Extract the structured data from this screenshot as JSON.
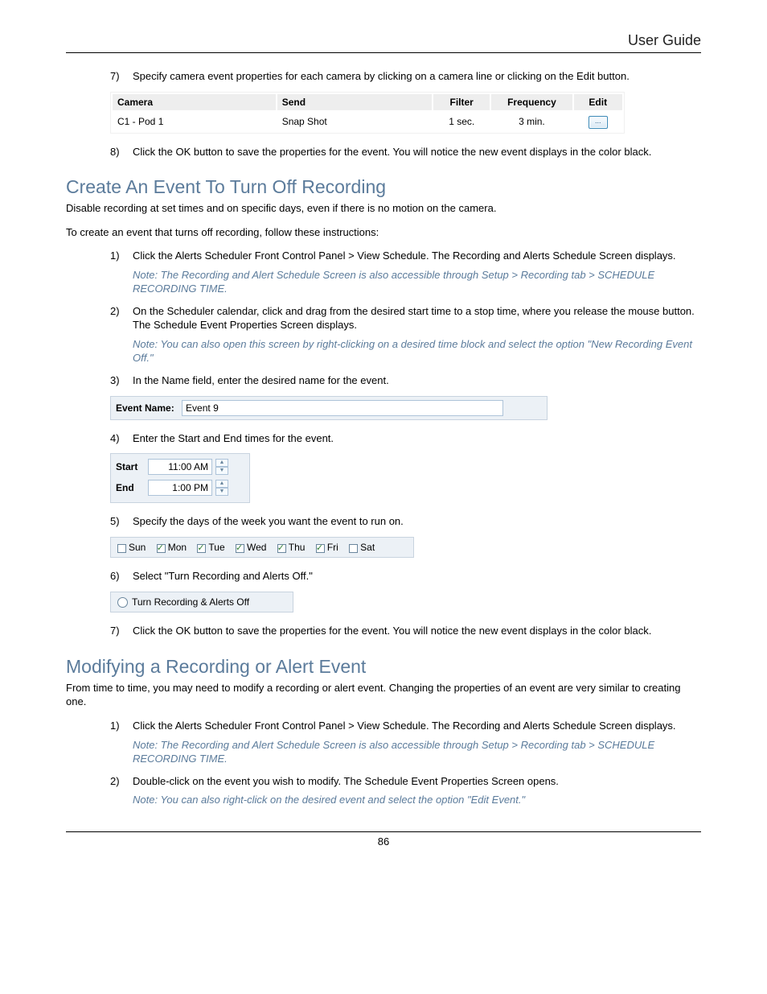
{
  "header": {
    "title": "User Guide"
  },
  "step7": {
    "num": "7)",
    "text": "Specify camera event properties for each camera by clicking on a camera line or clicking on the Edit button."
  },
  "camtable": {
    "headers": {
      "camera": "Camera",
      "send": "Send",
      "filter": "Filter",
      "frequency": "Frequency",
      "edit": "Edit"
    },
    "row": {
      "camera": "C1 - Pod 1",
      "send": "Snap Shot",
      "filter": "1 sec.",
      "frequency": "3 min.",
      "editbtn": "..."
    }
  },
  "step8": {
    "num": "8)",
    "text": "Click the OK button to save the properties for the event. You will notice the new event displays in the color black."
  },
  "sectionA": {
    "heading": "Create An Event To Turn Off Recording",
    "intro1": "Disable recording at set times and on specific days, even if there is no motion on the camera.",
    "intro2": "To create an event that turns off recording, follow these instructions:"
  },
  "a1": {
    "num": "1)",
    "text": "Click the Alerts Scheduler Front Control Panel > View Schedule.  The Recording and Alerts Schedule Screen displays.",
    "note": "Note: The Recording and Alert Schedule Screen is also accessible through Setup > Recording tab > SCHEDULE RECORDING TIME."
  },
  "a2": {
    "num": "2)",
    "text": "On the Scheduler calendar, click and drag from the desired start time to a stop time, where you release the mouse button.  The Schedule Event Properties Screen displays.",
    "note": "Note: You can also open this screen by right-clicking on a desired time block and select the option \"New Recording Event Off.\""
  },
  "a3": {
    "num": "3)",
    "text": "In the Name field, enter the desired name for the event."
  },
  "eventname": {
    "label": "Event Name:",
    "value": "Event 9"
  },
  "a4": {
    "num": "4)",
    "text": "Enter the Start and End times for the event."
  },
  "times": {
    "startLabel": "Start",
    "startVal": "11:00 AM",
    "endLabel": "End",
    "endVal": "1:00 PM"
  },
  "a5": {
    "num": "5)",
    "text": "Specify the days of the week you want the event to run on."
  },
  "days": {
    "sun": "Sun",
    "mon": "Mon",
    "tue": "Tue",
    "wed": "Wed",
    "thu": "Thu",
    "fri": "Fri",
    "sat": "Sat"
  },
  "a6": {
    "num": "6)",
    "text": "Select \"Turn Recording and Alerts Off.\""
  },
  "radio": {
    "label": "Turn Recording & Alerts Off"
  },
  "a7": {
    "num": "7)",
    "text": "Click the OK button to save the properties for the event. You will notice the new event displays in the color black."
  },
  "sectionB": {
    "heading": "Modifying a Recording or Alert Event",
    "intro": "From time to time, you may need to modify a recording or alert event. Changing the properties of an event  are very similar to creating one."
  },
  "b1": {
    "num": "1)",
    "text": "Click the Alerts Scheduler Front Control Panel > View Schedule.  The Recording and Alerts Schedule Screen displays.",
    "note": "Note: The Recording and Alert Schedule Screen is also accessible through Setup > Recording tab > SCHEDULE RECORDING TIME."
  },
  "b2": {
    "num": "2)",
    "text": "Double-click on the event you wish to modify.  The Schedule Event Properties Screen opens.",
    "note": "Note: You can also right-click on the desired event and select the option \"Edit Event.\""
  },
  "pagenum": "86"
}
